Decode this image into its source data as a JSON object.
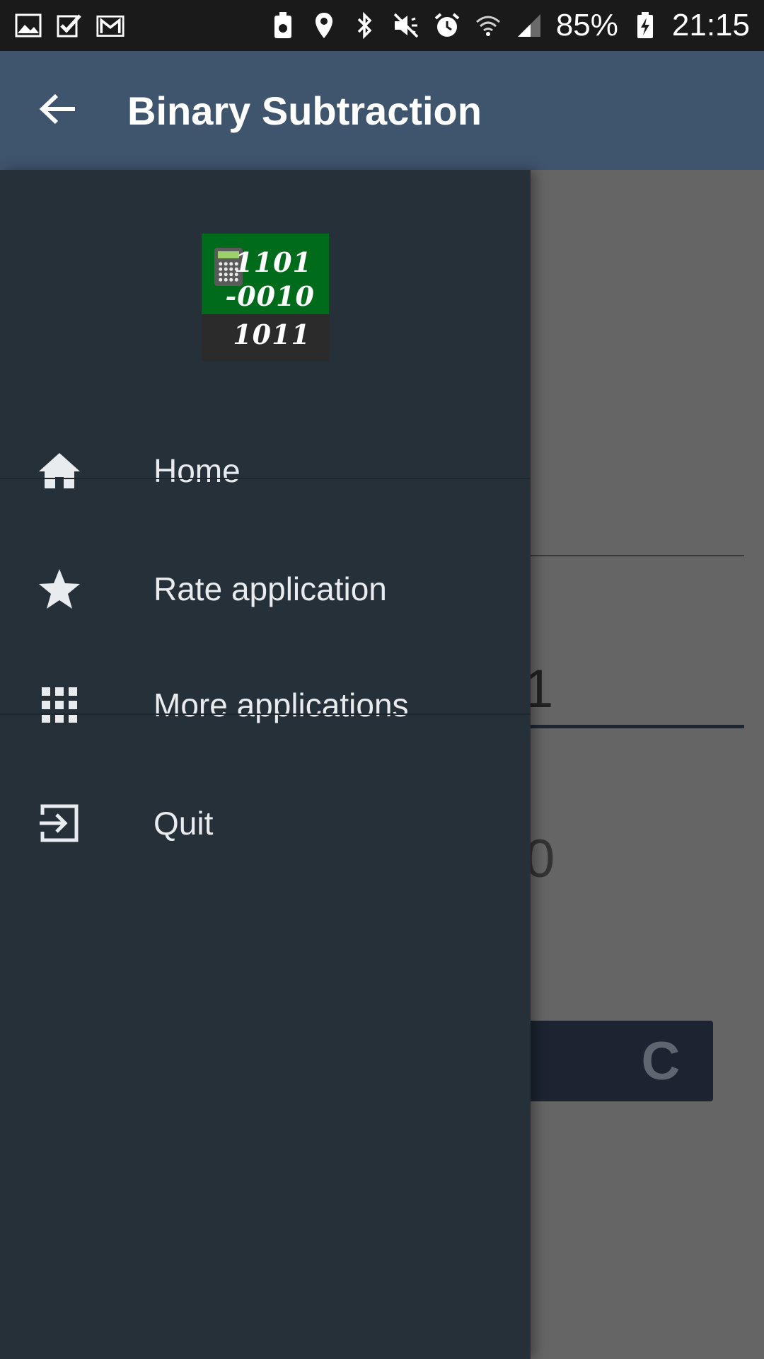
{
  "status_bar": {
    "battery_percent": "85%",
    "time": "21:15",
    "left_icons": [
      "gallery-icon",
      "tasks-check-icon",
      "gmail-icon"
    ],
    "right_icons": [
      "battery-saver-icon",
      "location-icon",
      "bluetooth-icon",
      "mute-icon",
      "alarm-icon",
      "wifi-icon",
      "signal-icon",
      "battery-charging-icon"
    ]
  },
  "app_bar": {
    "title": "Binary Subtraction",
    "back_icon": "arrow-back-icon",
    "background": "#3f546d"
  },
  "drawer": {
    "background": "#263039",
    "logo": {
      "line1": "1101",
      "line2": "-0010",
      "line3": "1011",
      "top_color": "#006b1a",
      "bottom_color": "#2b2b2b"
    },
    "items": [
      {
        "label": "Home",
        "icon": "home-icon"
      },
      {
        "label": "Rate application",
        "icon": "star-icon"
      },
      {
        "label": "More applications",
        "icon": "apps-grid-icon"
      },
      {
        "label": "Quit",
        "icon": "exit-icon"
      }
    ]
  },
  "background_content": {
    "input_digit": "1",
    "result_digit": "0",
    "clear_button_label": "C"
  }
}
